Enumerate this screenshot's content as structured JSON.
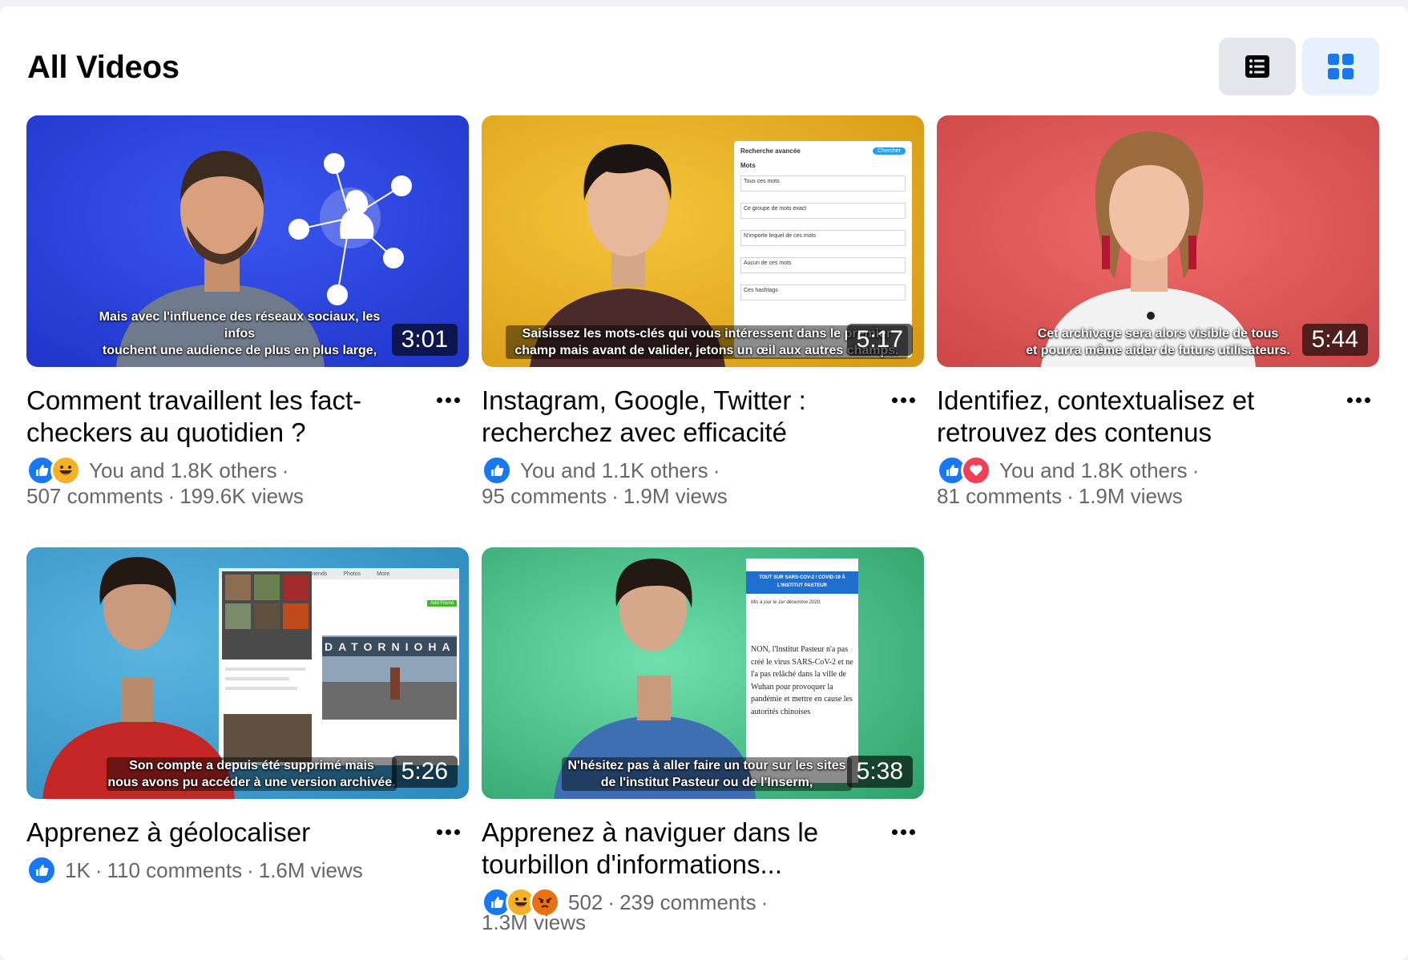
{
  "header": {
    "title": "All Videos",
    "list_view_icon": "list-view-icon",
    "grid_view_icon": "grid-view-icon",
    "active_view": "grid",
    "accent_color": "#1877f2"
  },
  "videos": [
    {
      "title": "Comment travaillent les fact-checkers au quotidien ?",
      "duration": "3:01",
      "caption": "Mais avec l'influence des réseaux sociaux, les infos\ntouchent une audience de plus en plus large,",
      "reactions": [
        "like",
        "haha"
      ],
      "reactors": "You and 1.8K others",
      "comments": "507 comments",
      "views": "199.6K views"
    },
    {
      "title": "Instagram, Google, Twitter : recherchez avec efficacité",
      "duration": "5:17",
      "caption": "Saisissez les mots-clés qui vous intéressent dans le premier\nchamp mais avant de valider, jetons un œil aux autres champs.",
      "reactions": [
        "like"
      ],
      "reactors": "You and 1.1K others",
      "comments": "95 comments",
      "views": "1.9M views",
      "overlay": {
        "header": "Recherche avancée",
        "button": "Chercher",
        "section": "Mots",
        "fields": [
          "Tous ces mots",
          "Ce groupe de mots exact",
          "N'importe lequel de ces mots",
          "Aucun de ces mots",
          "Ces hashtags"
        ]
      }
    },
    {
      "title": "Identifiez, contextualisez et retrouvez des contenus",
      "duration": "5:44",
      "caption": "Cet archivage sera alors visible de tous\net pourra même aider de futurs utilisateurs.",
      "reactions": [
        "like",
        "love"
      ],
      "reactors": "You and 1.8K others",
      "comments": "81 comments",
      "views": "1.9M views"
    },
    {
      "title": "Apprenez à géolocaliser",
      "duration": "5:26",
      "caption": "Son compte a depuis été supprimé mais\nnous avons pu accéder à une version archivée.",
      "reactions": [
        "like"
      ],
      "reactors": "1K",
      "comments": "110 comments",
      "views": "1.6M views",
      "overlay": {
        "tabs": [
          "Friends",
          "Photos",
          "More"
        ],
        "button": "Add Friend",
        "sign": "DATORNIOHA"
      }
    },
    {
      "title": "Apprenez à naviguer dans le tourbillon d'informations...",
      "duration": "5:38",
      "caption": "N'hésitez pas à aller faire un tour sur les sites\nde l'institut Pasteur ou de l'Inserm,",
      "reactions": [
        "like",
        "haha",
        "angry"
      ],
      "reactors": "502",
      "comments": "239 comments",
      "views": "1.3M views",
      "overlay": {
        "banner": "TOUT SUR SARS-COV-2 / COVID-19 À L'INSTITUT PASTEUR",
        "updated": "Mis à jour le 1er décembre 2020.",
        "body": "NON, l'Institut Pasteur n'a pas créé le virus SARS-CoV-2 et ne l'a pas relâché dans la ville de Wuhan pour provoquer la pandémie et mettre en cause les autorités chinoises"
      }
    }
  ]
}
